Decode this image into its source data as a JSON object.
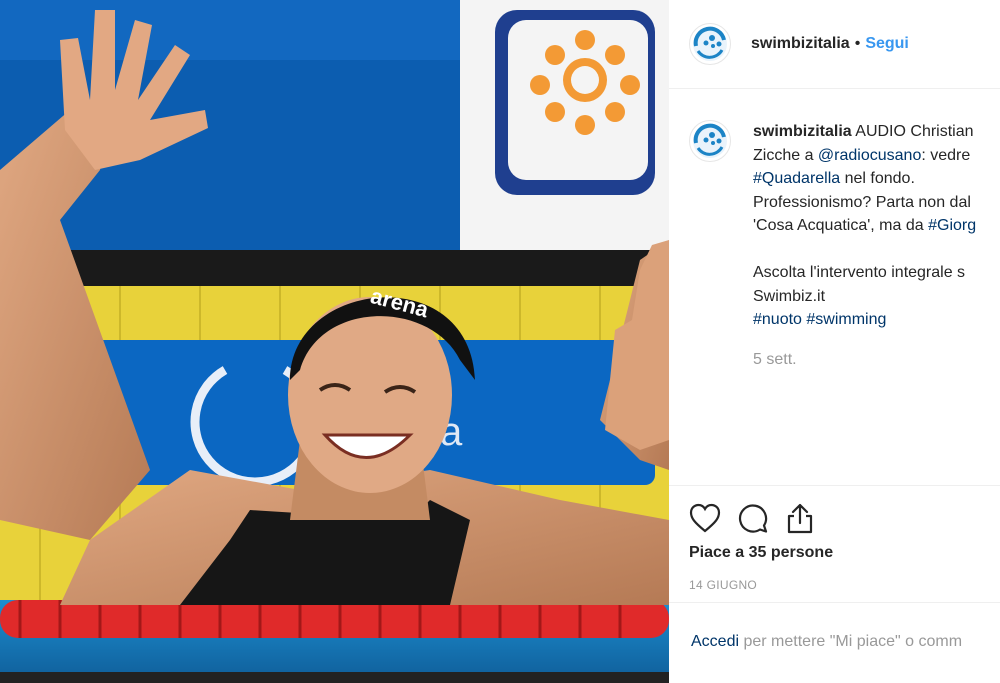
{
  "header": {
    "username": "swimbizitalia",
    "separator": "•",
    "follow_label": "Segui"
  },
  "photo": {
    "cap_brand": "arena",
    "description_icon": "swimmer-photo"
  },
  "caption": {
    "username": "swimbizitalia",
    "line1_rest": "AUDIO Christian",
    "line2_prefix": "Zicche a ",
    "line2_mention": "@radiocusano",
    "line2_rest": ": vedre",
    "line3_hashtag": "#Quadarella",
    "line3_rest": " nel fondo.",
    "line4": "Professionismo? Parta non dal",
    "line5_prefix": "'Cosa Acquatica', ma da ",
    "line5_hashtag": "#Giorg",
    "line6": "Ascolta l'intervento integrale s",
    "line7": "Swimbiz.it",
    "hashtag_nuoto": "#nuoto",
    "hashtag_swimming": "#swimming",
    "time_ago": "5 sett."
  },
  "actions": {
    "icons": [
      "heart-icon",
      "comment-icon",
      "share-icon"
    ],
    "likes_text": "Piace a 35 persone",
    "date": "14 GIUGNO"
  },
  "login": {
    "link_label": "Accedi",
    "rest_text": " per mettere \"Mi piace\" o comm"
  },
  "colors": {
    "link_blue": "#3897f0",
    "hashtag_navy": "#003569",
    "muted_gray": "#999999"
  }
}
